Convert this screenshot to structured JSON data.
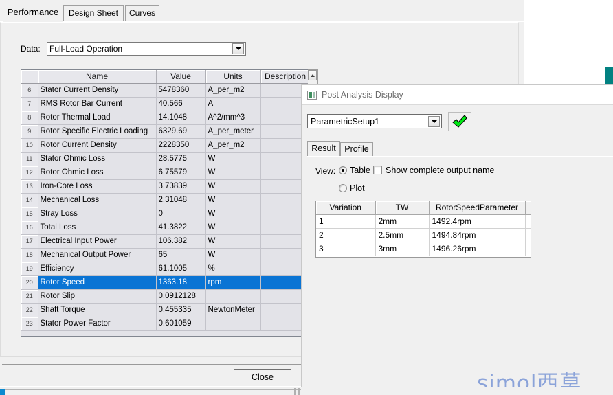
{
  "main_window": {
    "tabs": [
      {
        "label": "Performance",
        "active": true
      },
      {
        "label": "Design Sheet",
        "active": false
      },
      {
        "label": "Curves",
        "active": false
      }
    ],
    "data_label": "Data:",
    "data_combo": {
      "value": "Full-Load Operation",
      "icon": "chevron-down-icon"
    },
    "grid": {
      "columns": [
        "",
        "Name",
        "Value",
        "Units",
        "Description",
        ""
      ],
      "rows": [
        {
          "n": "6",
          "name": "Stator Current Density",
          "value": "5478360",
          "units": "A_per_m2",
          "desc": "",
          "selected": false
        },
        {
          "n": "7",
          "name": "RMS Rotor Bar Current",
          "value": "40.566",
          "units": "A",
          "desc": "",
          "selected": false
        },
        {
          "n": "8",
          "name": "Rotor Thermal Load",
          "value": "14.1048",
          "units": "A^2/mm^3",
          "desc": "",
          "selected": false
        },
        {
          "n": "9",
          "name": "Rotor Specific Electric Loading",
          "value": "6329.69",
          "units": "A_per_meter",
          "desc": "",
          "selected": false
        },
        {
          "n": "10",
          "name": "Rotor Current Density",
          "value": "2228350",
          "units": "A_per_m2",
          "desc": "",
          "selected": false
        },
        {
          "n": "11",
          "name": "Stator Ohmic Loss",
          "value": "28.5775",
          "units": "W",
          "desc": "",
          "selected": false
        },
        {
          "n": "12",
          "name": "Rotor Ohmic Loss",
          "value": "6.75579",
          "units": "W",
          "desc": "",
          "selected": false
        },
        {
          "n": "13",
          "name": "Iron-Core Loss",
          "value": "3.73839",
          "units": "W",
          "desc": "",
          "selected": false
        },
        {
          "n": "14",
          "name": "Mechanical Loss",
          "value": "2.31048",
          "units": "W",
          "desc": "",
          "selected": false
        },
        {
          "n": "15",
          "name": "Stray Loss",
          "value": "0",
          "units": "W",
          "desc": "",
          "selected": false
        },
        {
          "n": "16",
          "name": "Total Loss",
          "value": "41.3822",
          "units": "W",
          "desc": "",
          "selected": false
        },
        {
          "n": "17",
          "name": "Electrical Input Power",
          "value": "106.382",
          "units": "W",
          "desc": "",
          "selected": false
        },
        {
          "n": "18",
          "name": "Mechanical Output Power",
          "value": "65",
          "units": "W",
          "desc": "",
          "selected": false
        },
        {
          "n": "19",
          "name": "Efficiency",
          "value": "61.1005",
          "units": "%",
          "desc": "",
          "selected": false
        },
        {
          "n": "20",
          "name": "Rotor Speed",
          "value": "1363.18",
          "units": "rpm",
          "desc": "",
          "selected": true
        },
        {
          "n": "21",
          "name": "Rotor Slip",
          "value": "0.0912128",
          "units": "",
          "desc": "",
          "selected": false
        },
        {
          "n": "22",
          "name": "Shaft Torque",
          "value": "0.455335",
          "units": "NewtonMeter",
          "desc": "",
          "selected": false
        },
        {
          "n": "23",
          "name": "Stator Power Factor",
          "value": "0.601059",
          "units": "",
          "desc": "",
          "selected": false
        }
      ]
    },
    "scrollbar": {
      "up_icon": "scroll-up-arrow-icon"
    },
    "close_button": "Close"
  },
  "post_analysis_dialog": {
    "title": "Post Analysis Display",
    "title_icon": "application-window-icon",
    "setup_combo": {
      "value": "ParametricSetup1",
      "icon": "chevron-down-icon"
    },
    "ok_button_icon": "green-checkmark-icon",
    "tabs": [
      {
        "label": "Result",
        "active": true
      },
      {
        "label": "Profile",
        "active": false
      }
    ],
    "view": {
      "label": "View:",
      "options": [
        {
          "label": "Table",
          "selected": true
        },
        {
          "label": "Plot",
          "selected": false
        }
      ],
      "checkbox": {
        "label": "Show complete output name",
        "checked": false
      }
    },
    "results_table": {
      "columns": [
        "Variation",
        "TW",
        "RotorSpeedParameter",
        ""
      ],
      "rows": [
        {
          "variation": "1",
          "tw": "2mm",
          "rotor_speed": "1492.4rpm",
          "pad": ""
        },
        {
          "variation": "2",
          "tw": "2.5mm",
          "rotor_speed": "1494.84rpm",
          "pad": ""
        },
        {
          "variation": "3",
          "tw": "3mm",
          "rotor_speed": "1496.26rpm",
          "pad": ""
        }
      ]
    }
  },
  "watermark": {
    "latin": "simol",
    "chinese": "西莫"
  },
  "colors": {
    "selection_blue": "#0a74d4",
    "accent_teal": "#028181",
    "checkmark_green": "#00e815",
    "watermark_blue": "#7a96d6",
    "taskbar_blue": "#0b8ad0"
  }
}
